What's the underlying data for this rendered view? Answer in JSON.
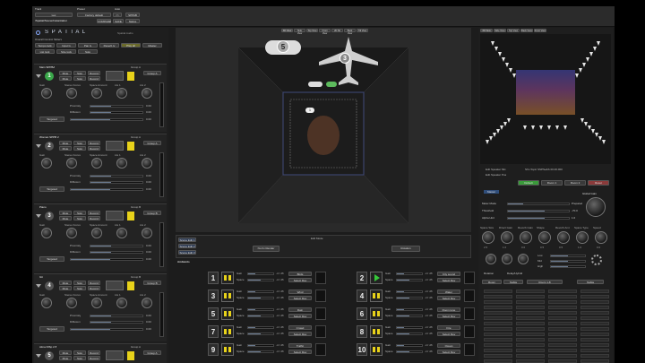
{
  "top": {
    "track_label": "Track",
    "preset_label": "Preset",
    "auto_label": "Auto",
    "track_value": "Lex",
    "preset_value": "Factory default",
    "arrows": "<>",
    "apply_label": "SPPAB",
    "path_text": "/Spatial/Scene/Instantiation",
    "cut_label": "COMPARE",
    "copy_label": "SAFE",
    "native_label": "Native"
  },
  "brand": {
    "name": "S P A T I A L",
    "sub": "Spatial Audio"
  },
  "global": {
    "title": "Overall Control Sliders",
    "buttons": [
      "Tempo lock",
      "Input lv",
      "Pan lv",
      "Reverb lv",
      "Play all",
      "Master"
    ],
    "row2": [
      "List lock",
      "Size lock",
      "Solo"
    ]
  },
  "channels": [
    {
      "name": "Main SPPBA",
      "num": "1",
      "group": "Group A"
    },
    {
      "name": "Woman SPPB 2",
      "num": "2",
      "group": "Group A"
    },
    {
      "name": "Piano",
      "num": "3",
      "group": "Group B"
    },
    {
      "name": "Gtr",
      "num": "4",
      "group": "Group B"
    },
    {
      "name": "Alma DISp 2 8",
      "num": "5",
      "group": "Group A"
    }
  ],
  "channel_labels": {
    "row1": [
      "Mute",
      "Solo",
      "Record"
    ],
    "row2": [
      "Mute",
      "Solo",
      "Record"
    ],
    "knobs": [
      "Gain",
      "Stereo Focus",
      "Space Amount",
      "Lfe 1",
      "Lfe 2"
    ],
    "param_a": "Proximity",
    "param_b": "Diffusion",
    "target": "Targeted",
    "val": "0.00"
  },
  "viewport": {
    "tabs": [
      "3D View",
      "Side View",
      "Top View",
      "Front View",
      "2D Sit",
      "Back View",
      "Tilt View"
    ],
    "objects": [
      "5",
      "3",
      "1"
    ]
  },
  "mid": {
    "edit_mode": "Edit Mode",
    "modes": [
      "Scene Edit 1",
      "Scene Edit 2",
      "Scene Edit 3"
    ],
    "center_btn": "No Fx Render",
    "right_btn": "Rotation",
    "ambients": "Ambients",
    "rows_left": [
      "1",
      "3",
      "5",
      "7",
      "9"
    ],
    "rows_right": [
      "2",
      "4",
      "6",
      "8",
      "10"
    ],
    "field_a": "Gain",
    "field_b": "Space",
    "db": "-inf dB",
    "select": "Select Rev",
    "name_fields": [
      "Birds",
      "Wind",
      "Rain",
      "Crowd",
      "Traffic",
      "City sound",
      "Water",
      "Room tone",
      "Fire",
      "Ocean"
    ]
  },
  "right": {
    "tabs": [
      "3D View",
      "Side View",
      "Top View",
      "Back View",
      "Front View"
    ],
    "info": [
      "Edit Speaker Mix",
      "Edit Speaker Pos"
    ],
    "status_text": "Sfm Topic SSPSe&S 00.00.000",
    "buttons": [
      "Default",
      "Room 1",
      "Room 2",
      "Reset"
    ],
    "section": "Master",
    "fields": [
      "Meter Mode",
      "Threshold",
      "Alpha Hint"
    ],
    "field_vals": [
      "Prepared",
      "-70.0",
      "1.0"
    ],
    "global_gain": "Global Gain",
    "knob_labels": [
      "Space Size",
      "Direct Gain",
      "Reverb Gain",
      "Shape",
      "Reverb Amt",
      "Space Type",
      "Speed"
    ],
    "knob_vals": [
      "2.5",
      "1.0",
      "0.0",
      "0.5",
      "0.5",
      "1.0",
      "0.0"
    ],
    "eq": [
      "Low",
      "Mid",
      "High"
    ],
    "rotation": "Rotation",
    "delay": "Delay/Hybrid",
    "options": [
      "Room",
      "Nabla"
    ],
    "sel": "Room 1-8"
  }
}
